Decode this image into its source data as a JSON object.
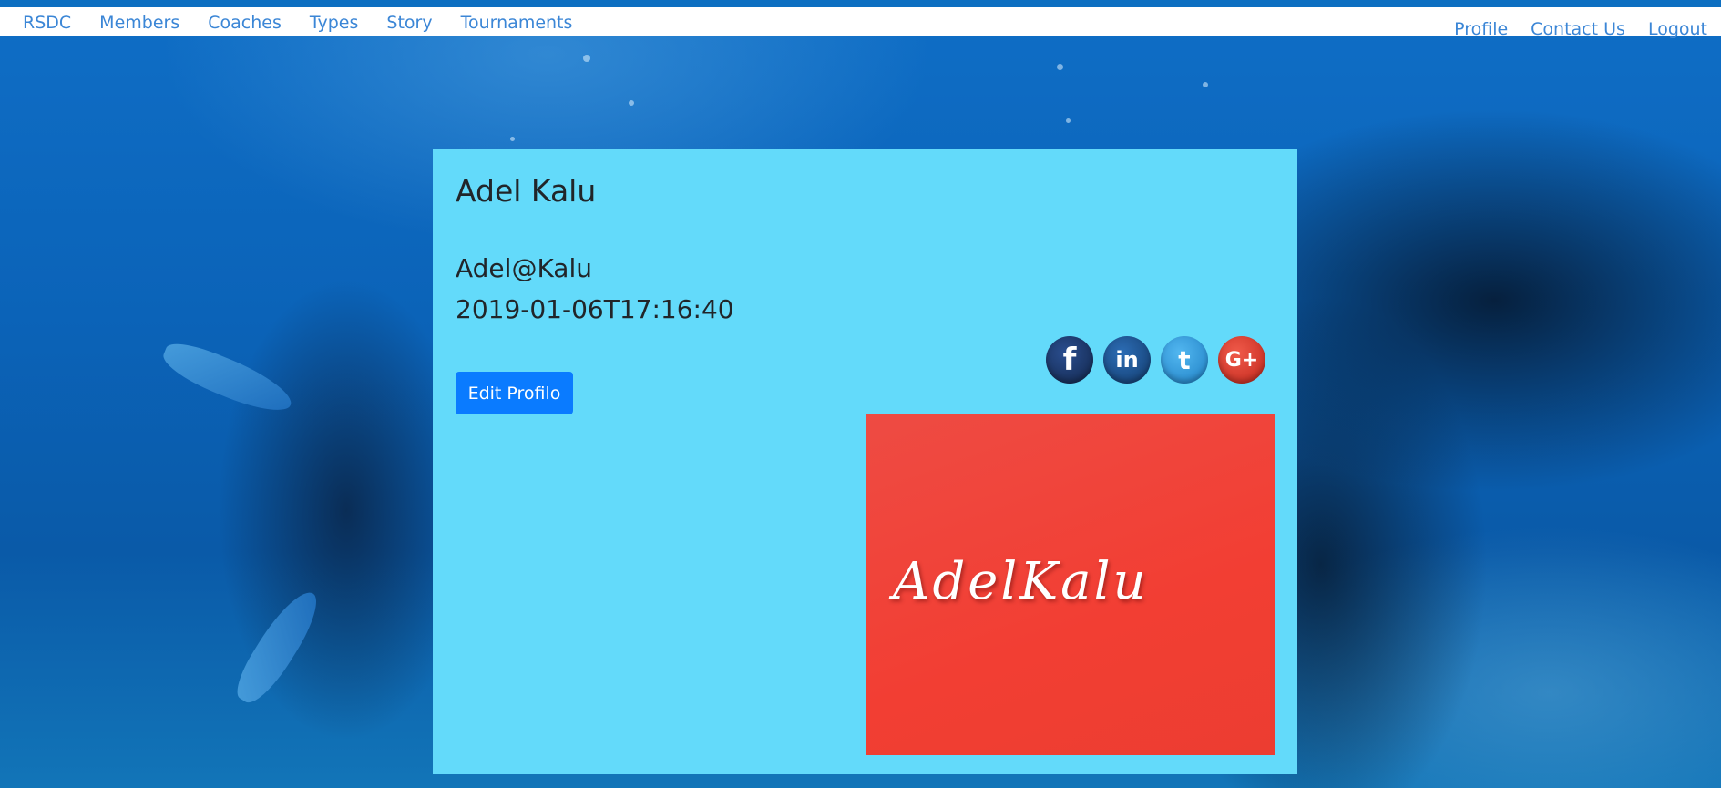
{
  "nav": {
    "left": [
      {
        "label": "RSDC"
      },
      {
        "label": "Members"
      },
      {
        "label": "Coaches"
      },
      {
        "label": "Types"
      },
      {
        "label": "Story"
      },
      {
        "label": "Tournaments"
      }
    ],
    "right": [
      {
        "label": "Profile"
      },
      {
        "label": "Contact Us"
      },
      {
        "label": "Logout"
      }
    ]
  },
  "profile": {
    "name": "Adel Kalu",
    "username": "Adel@Kalu",
    "created": "2019-01-06T17:16:40",
    "edit_label": "Edit Profilo",
    "signature_text": "AdelKalu",
    "social": [
      {
        "name": "facebook-icon",
        "glyph": "f"
      },
      {
        "name": "linkedin-icon",
        "glyph": "in"
      },
      {
        "name": "twitter-icon",
        "glyph": "t"
      },
      {
        "name": "google-plus-icon",
        "glyph": "G+"
      }
    ]
  },
  "colors": {
    "nav_link": "#3b86d6",
    "card_bg": "#63dafa",
    "button_bg": "#0a7bff",
    "signature_bg": "#f23e33"
  }
}
